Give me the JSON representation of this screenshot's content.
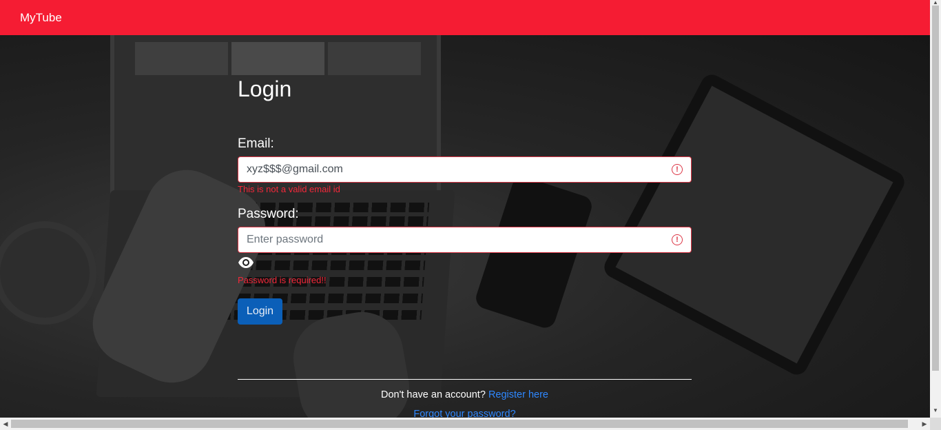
{
  "navbar": {
    "brand": "MyTube"
  },
  "login": {
    "title": "Login",
    "email_label": "Email:",
    "email_value": "xyz$$$@gmail.com",
    "email_error": "This is not a valid email id",
    "password_label": "Password:",
    "password_placeholder": "Enter password",
    "password_error": "Password is required!!",
    "submit_label": "Login"
  },
  "footer": {
    "register_prompt": "Don't have an account?",
    "register_link": "Register here",
    "forgot_link": "Forgot your password?"
  },
  "colors": {
    "navbar": "#f51c33",
    "error": "#dc3545",
    "button": "#0b5fb8",
    "link": "#2f88ff"
  },
  "icons": {
    "field_error": "exclamation-circle-icon",
    "password_toggle": "eye-icon"
  }
}
